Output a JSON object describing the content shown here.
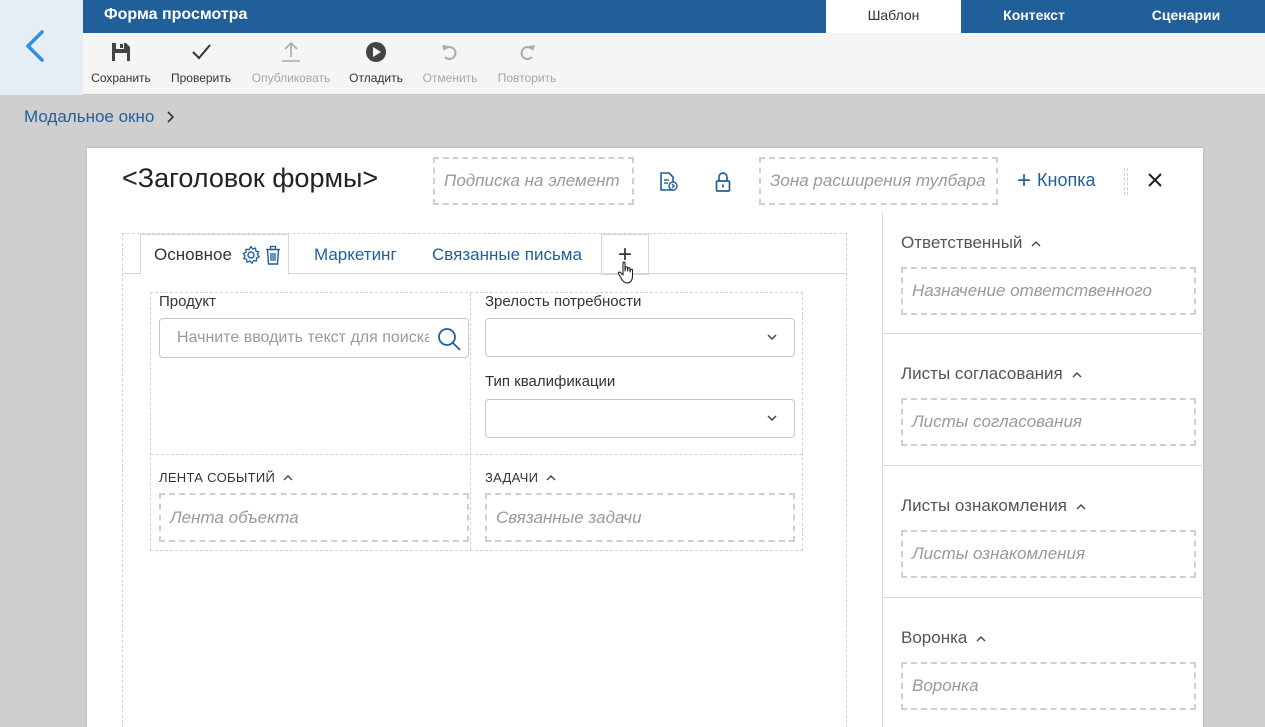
{
  "app": {
    "title": "Форма просмотра",
    "tabs": [
      {
        "label": "Шаблон",
        "active": true
      },
      {
        "label": "Контекст",
        "active": false
      },
      {
        "label": "Сценарии",
        "active": false
      }
    ]
  },
  "toolbar": {
    "save": "Сохранить",
    "check": "Проверить",
    "publish": "Опубликовать",
    "debug": "Отладить",
    "undo": "Отменить",
    "redo": "Повторить"
  },
  "breadcrumb": {
    "label": "Модальное окно"
  },
  "modal": {
    "title": "<Заголовок формы>",
    "subscribe_placeholder": "Подписка на элемент",
    "toolbar_extension_placeholder": "Зона расширения тулбара",
    "add_button_label": "Кнопка",
    "tabs": {
      "main": "Основное",
      "marketing": "Маркетинг",
      "letters": "Связанные письма",
      "add": "+"
    },
    "fields": {
      "product_label": "Продукт",
      "product_placeholder": "Начните вводить текст для поиска",
      "maturity_label": "Зрелость потребности",
      "maturity_value": "",
      "qualification_label": "Тип квалификации",
      "qualification_value": ""
    },
    "sections": {
      "events_label": "ЛЕНТА СОБЫТИЙ",
      "events_placeholder": "Лента объекта",
      "tasks_label": "ЗАДАЧИ",
      "tasks_placeholder": "Связанные задачи"
    },
    "right_panel": [
      {
        "title": "Ответственный",
        "placeholder": "Назначение ответственного"
      },
      {
        "title": "Листы согласования",
        "placeholder": "Листы согласования"
      },
      {
        "title": "Листы ознакомления",
        "placeholder": "Листы ознакомления"
      },
      {
        "title": "Воронка",
        "placeholder": "Воронка"
      }
    ]
  },
  "colors": {
    "brand": "#215f9a",
    "topbar": "#215f9a",
    "background": "#cfcfcf",
    "link": "#215f9a",
    "back_arrow": "#2f8fe0"
  }
}
